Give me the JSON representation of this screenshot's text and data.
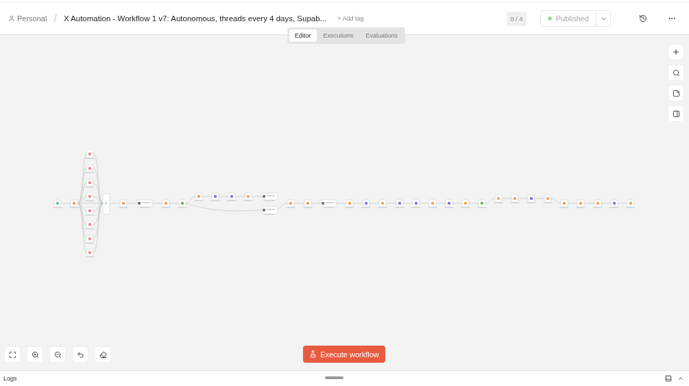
{
  "breadcrumb": {
    "project": "Personal",
    "separator": "/",
    "workflow_title": "X Automation - Workflow 1 v7: Autonomous, threads every 4 days, Supab...",
    "add_tag": "+ Add tag"
  },
  "tabs": [
    {
      "label": "Editor",
      "selected": true
    },
    {
      "label": "Executions",
      "selected": false
    },
    {
      "label": "Evaluations",
      "selected": false
    }
  ],
  "counter": "0 / 4",
  "publish": {
    "label": "Published",
    "active": true
  },
  "execute_button": "Execute workflow",
  "logs_panel": {
    "label": "Logs"
  }
}
